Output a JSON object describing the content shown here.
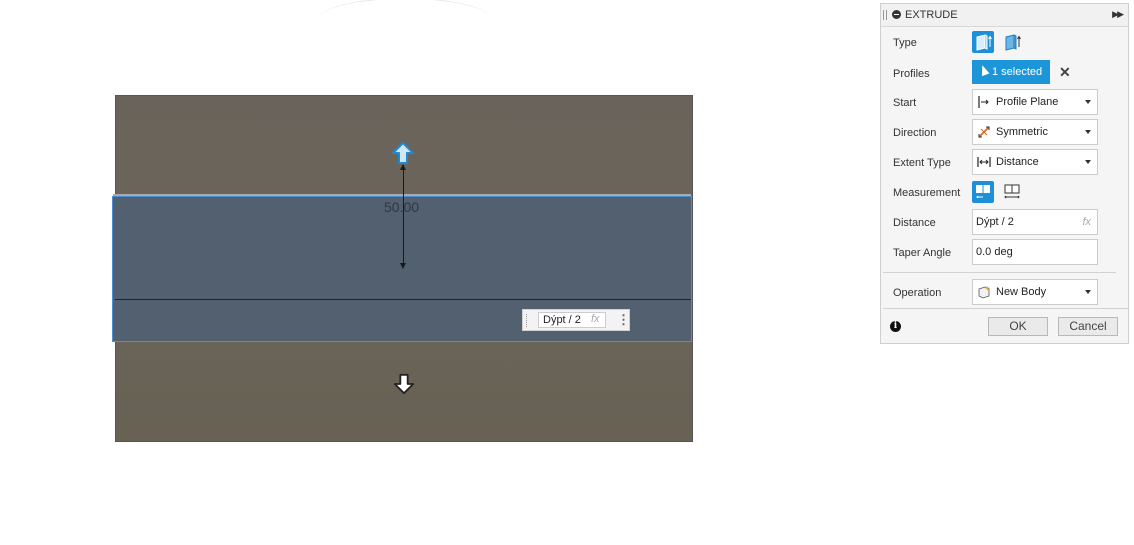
{
  "viewport": {
    "dimension_value": "50.00",
    "inline_expression": "Dýpt / 2",
    "inline_fx": "fx",
    "inline_menu": "⋮"
  },
  "panel": {
    "title": "EXTRUDE",
    "expand_glyph": "▶▶",
    "rows": {
      "type": {
        "label": "Type"
      },
      "profiles": {
        "label": "Profiles",
        "selection": "1 selected",
        "clear": "✕"
      },
      "start": {
        "label": "Start",
        "value": "Profile Plane"
      },
      "direction": {
        "label": "Direction",
        "value": "Symmetric"
      },
      "extent_type": {
        "label": "Extent Type",
        "value": "Distance"
      },
      "measurement": {
        "label": "Measurement"
      },
      "distance": {
        "label": "Distance",
        "value": "Dýpt / 2",
        "fx": "fx"
      },
      "taper_angle": {
        "label": "Taper Angle",
        "value": "0.0 deg"
      },
      "operation": {
        "label": "Operation",
        "value": "New Body"
      }
    },
    "info_glyph": "i",
    "ok_label": "OK",
    "cancel_label": "Cancel"
  },
  "colors": {
    "accent": "#1c96d9",
    "viewport_bg": "#6b655c",
    "selection_fill": "#52606f",
    "selection_border": "#4d8fd6"
  }
}
